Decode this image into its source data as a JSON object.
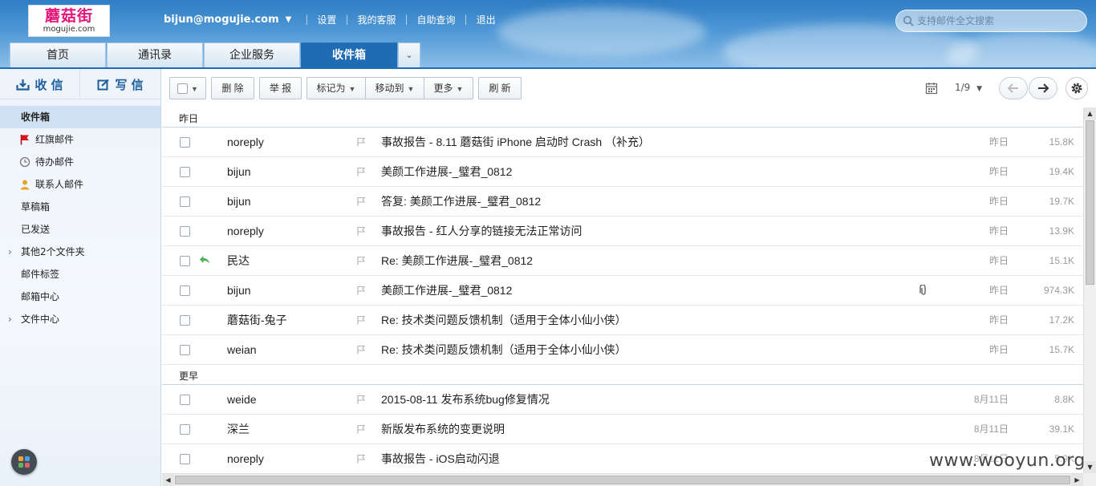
{
  "header": {
    "logo_text": "蘑菇街",
    "logo_sub": "mogujie.com",
    "user_email": "bijun@mogujie.com",
    "links": [
      "设置",
      "我的客服",
      "自助查询",
      "退出"
    ],
    "search_placeholder": "支持邮件全文搜索",
    "tabs": [
      {
        "label": "首页",
        "active": false
      },
      {
        "label": "通讯录",
        "active": false
      },
      {
        "label": "企业服务",
        "active": false
      },
      {
        "label": "收件箱",
        "active": true
      }
    ]
  },
  "sidebar": {
    "receive_label": "收 信",
    "compose_label": "写 信",
    "folders": [
      {
        "label": "收件箱",
        "active": true,
        "icon": ""
      },
      {
        "label": "红旗邮件",
        "active": false,
        "icon": "red-flag-icon"
      },
      {
        "label": "待办邮件",
        "active": false,
        "icon": "clock-icon"
      },
      {
        "label": "联系人邮件",
        "active": false,
        "icon": "person-icon"
      },
      {
        "label": "草稿箱",
        "active": false,
        "icon": ""
      },
      {
        "label": "已发送",
        "active": false,
        "icon": ""
      },
      {
        "label": "其他2个文件夹",
        "active": false,
        "icon": "",
        "expandable": true
      },
      {
        "label": "邮件标签",
        "active": false,
        "icon": ""
      },
      {
        "label": "邮箱中心",
        "active": false,
        "icon": ""
      },
      {
        "label": "文件中心",
        "active": false,
        "icon": "",
        "expandable": true
      }
    ]
  },
  "toolbar": {
    "delete_label": "删 除",
    "report_label": "举 报",
    "mark_label": "标记为",
    "move_label": "移动到",
    "more_label": "更多",
    "refresh_label": "刷 新",
    "page_indicator": "1/9"
  },
  "groups": [
    {
      "label": "昨日",
      "rows": [
        {
          "sender": "noreply",
          "subject": "事故报告 - 8.11 蘑菇街 iPhone 启动时 Crash （补充）",
          "date": "昨日",
          "size": "15.8K",
          "replied": false,
          "attachment": false
        },
        {
          "sender": "bijun",
          "subject": "美颜工作进展-_璧君_0812",
          "date": "昨日",
          "size": "19.4K",
          "replied": false,
          "attachment": false
        },
        {
          "sender": "bijun",
          "subject": "答复: 美颜工作进展-_璧君_0812",
          "date": "昨日",
          "size": "19.7K",
          "replied": false,
          "attachment": false
        },
        {
          "sender": "noreply",
          "subject": "事故报告 - 红人分享的链接无法正常访问",
          "date": "昨日",
          "size": "13.9K",
          "replied": false,
          "attachment": false
        },
        {
          "sender": "民达",
          "subject": "Re: 美颜工作进展-_璧君_0812",
          "date": "昨日",
          "size": "15.1K",
          "replied": true,
          "attachment": false
        },
        {
          "sender": "bijun",
          "subject": "美颜工作进展-_璧君_0812",
          "date": "昨日",
          "size": "974.3K",
          "replied": false,
          "attachment": true
        },
        {
          "sender": "蘑菇街-兔子",
          "subject": "Re: 技术类问题反馈机制（适用于全体小仙小侠）",
          "date": "昨日",
          "size": "17.2K",
          "replied": false,
          "attachment": false
        },
        {
          "sender": "weian",
          "subject": "Re: 技术类问题反馈机制（适用于全体小仙小侠）",
          "date": "昨日",
          "size": "15.7K",
          "replied": false,
          "attachment": false
        }
      ]
    },
    {
      "label": "更早",
      "rows": [
        {
          "sender": "weide",
          "subject": "2015-08-11 发布系统bug修复情况",
          "date": "8月11日",
          "size": "8.8K",
          "replied": false,
          "attachment": false
        },
        {
          "sender": "深兰",
          "subject": "新版发布系统的变更说明",
          "date": "8月11日",
          "size": "39.1K",
          "replied": false,
          "attachment": false
        },
        {
          "sender": "noreply",
          "subject": "事故报告 - iOS启动闪退",
          "date": "8月11日",
          "size": "5.9K",
          "replied": false,
          "attachment": false
        }
      ]
    }
  ],
  "watermark": "www.wooyun.org",
  "colors": {
    "accent": "#1f6cb4",
    "sidebar_bg": "#eef4fa",
    "active_folder": "#cfe1f2",
    "flag_red": "#d8121b",
    "reply_green": "#4caf50"
  }
}
